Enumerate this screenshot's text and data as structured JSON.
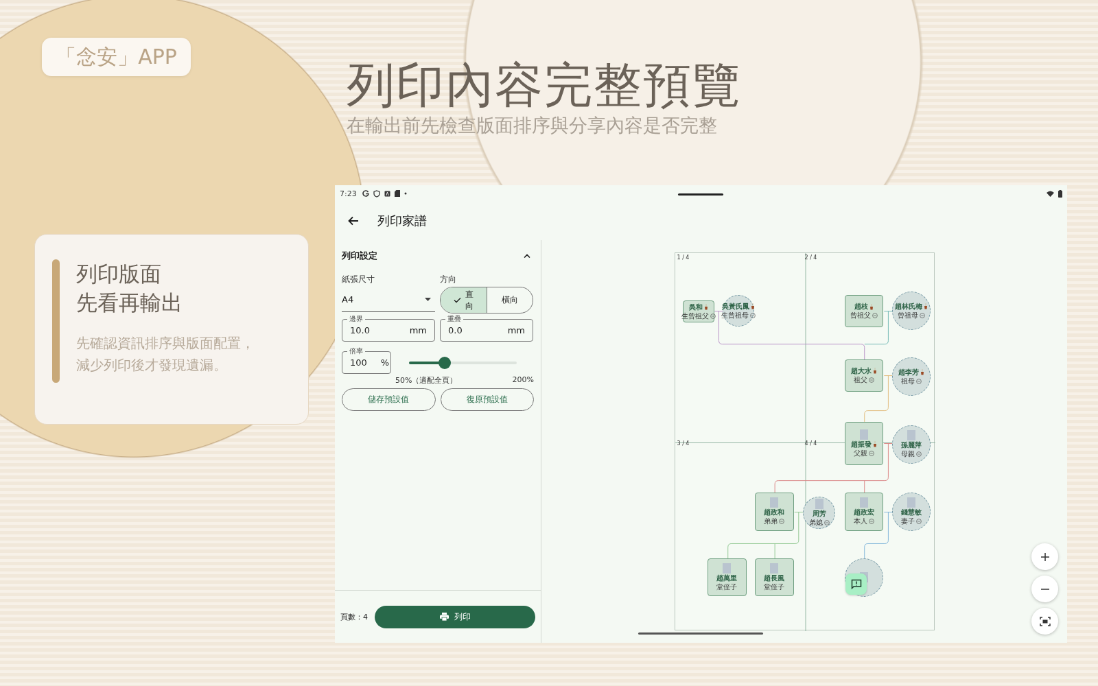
{
  "brand_badge": "「念安」APP",
  "headline": {
    "title": "列印內容完整預覽",
    "subtitle": "在輸出前先檢查版面排序與分享內容是否完整"
  },
  "feature_card": {
    "title_lines": [
      "列印版面",
      "先看再輸出"
    ],
    "body_lines": [
      "先確認資訊排序與版面配置，",
      "減少列印後才發現遺漏。"
    ]
  },
  "status_bar": {
    "time": "7:23"
  },
  "app_bar": {
    "title": "列印家譜"
  },
  "settings": {
    "title": "列印設定",
    "expanded": true,
    "paper_size": {
      "label": "紙張尺寸",
      "value": "A4"
    },
    "orientation": {
      "label": "方向",
      "options": [
        {
          "label": "直向",
          "selected": true
        },
        {
          "label": "橫向",
          "selected": false
        }
      ]
    },
    "margin": {
      "label": "邊界",
      "value": "10.0",
      "unit": "mm"
    },
    "overlap": {
      "label": "重疊",
      "value": "0.0",
      "unit": "mm"
    },
    "scale": {
      "label": "倍率",
      "value": "100",
      "unit": "%",
      "level": 0.33,
      "min_label": "50%（適配全頁）",
      "max_label": "200%"
    },
    "buttons": [
      "儲存預設值",
      "復原預設值"
    ]
  },
  "footer": {
    "page_count": "頁數：4",
    "print_button": "列印"
  },
  "preview": {
    "page_labels": [
      "1 / 4",
      "2 / 4",
      "3 / 4",
      "4 / 4"
    ],
    "members": [
      {
        "kind": "box",
        "name": "吳和",
        "relation": "生曾祖父",
        "memorial": true,
        "photo": false,
        "collapsible": true
      },
      {
        "kind": "circle",
        "name": "吳黃氏鳳",
        "relation": "生曾祖母",
        "memorial": true,
        "photo": false,
        "collapsible": true
      },
      {
        "kind": "box",
        "name": "趙枝",
        "relation": "曾祖父",
        "memorial": true,
        "photo": false,
        "collapsible": true
      },
      {
        "kind": "circle",
        "name": "趙林氏梅",
        "relation": "曾祖母",
        "memorial": true,
        "photo": false,
        "collapsible": true
      },
      {
        "kind": "box",
        "name": "趙大水",
        "relation": "祖父",
        "memorial": true,
        "photo": false,
        "collapsible": true
      },
      {
        "kind": "circle",
        "name": "趙李芳",
        "relation": "祖母",
        "memorial": true,
        "photo": false,
        "collapsible": true
      },
      {
        "kind": "box",
        "name": "趙振發",
        "relation": "父親",
        "memorial": true,
        "photo": true,
        "collapsible": true
      },
      {
        "kind": "circle",
        "name": "孫麗萍",
        "relation": "母親",
        "memorial": false,
        "photo": true,
        "collapsible": true
      },
      {
        "kind": "box",
        "name": "趙政和",
        "relation": "弟弟",
        "memorial": false,
        "photo": true,
        "collapsible": true
      },
      {
        "kind": "circle",
        "name": "周芳",
        "relation": "弟媳",
        "memorial": false,
        "photo": true,
        "collapsible": true
      },
      {
        "kind": "box",
        "name": "趙政宏",
        "relation": "本人",
        "memorial": false,
        "photo": true,
        "collapsible": true
      },
      {
        "kind": "circle",
        "name": "錢慧敏",
        "relation": "妻子",
        "memorial": false,
        "photo": true,
        "collapsible": true
      },
      {
        "kind": "box",
        "name": "趙萬里",
        "relation": "堂侄子",
        "memorial": false,
        "photo": true,
        "collapsible": false
      },
      {
        "kind": "box",
        "name": "趙長風",
        "relation": "堂侄子",
        "memorial": false,
        "photo": true,
        "collapsible": false
      },
      {
        "kind": "circle",
        "photo": true
      }
    ]
  }
}
